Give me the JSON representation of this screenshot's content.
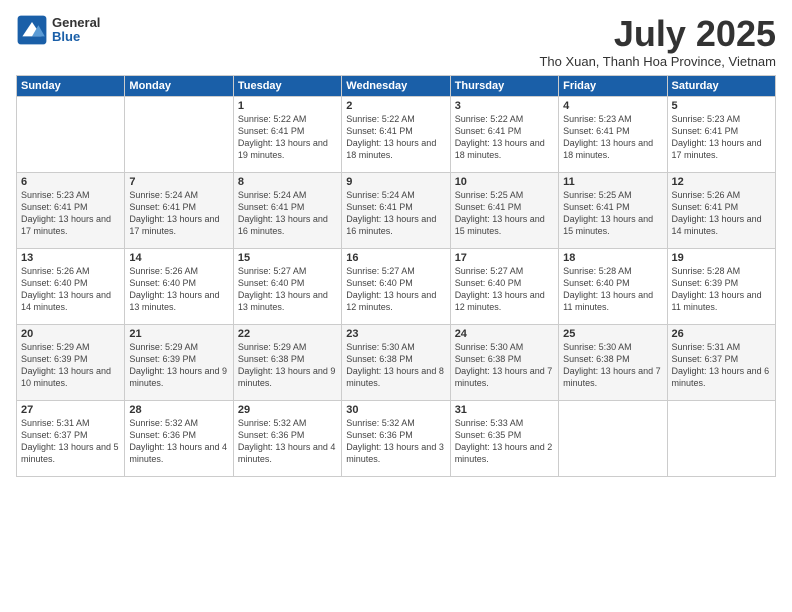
{
  "logo": {
    "general": "General",
    "blue": "Blue"
  },
  "title": "July 2025",
  "subtitle": "Tho Xuan, Thanh Hoa Province, Vietnam",
  "weekdays": [
    "Sunday",
    "Monday",
    "Tuesday",
    "Wednesday",
    "Thursday",
    "Friday",
    "Saturday"
  ],
  "weeks": [
    [
      {
        "day": "",
        "info": ""
      },
      {
        "day": "",
        "info": ""
      },
      {
        "day": "1",
        "info": "Sunrise: 5:22 AM\nSunset: 6:41 PM\nDaylight: 13 hours and 19 minutes."
      },
      {
        "day": "2",
        "info": "Sunrise: 5:22 AM\nSunset: 6:41 PM\nDaylight: 13 hours and 18 minutes."
      },
      {
        "day": "3",
        "info": "Sunrise: 5:22 AM\nSunset: 6:41 PM\nDaylight: 13 hours and 18 minutes."
      },
      {
        "day": "4",
        "info": "Sunrise: 5:23 AM\nSunset: 6:41 PM\nDaylight: 13 hours and 18 minutes."
      },
      {
        "day": "5",
        "info": "Sunrise: 5:23 AM\nSunset: 6:41 PM\nDaylight: 13 hours and 17 minutes."
      }
    ],
    [
      {
        "day": "6",
        "info": "Sunrise: 5:23 AM\nSunset: 6:41 PM\nDaylight: 13 hours and 17 minutes."
      },
      {
        "day": "7",
        "info": "Sunrise: 5:24 AM\nSunset: 6:41 PM\nDaylight: 13 hours and 17 minutes."
      },
      {
        "day": "8",
        "info": "Sunrise: 5:24 AM\nSunset: 6:41 PM\nDaylight: 13 hours and 16 minutes."
      },
      {
        "day": "9",
        "info": "Sunrise: 5:24 AM\nSunset: 6:41 PM\nDaylight: 13 hours and 16 minutes."
      },
      {
        "day": "10",
        "info": "Sunrise: 5:25 AM\nSunset: 6:41 PM\nDaylight: 13 hours and 15 minutes."
      },
      {
        "day": "11",
        "info": "Sunrise: 5:25 AM\nSunset: 6:41 PM\nDaylight: 13 hours and 15 minutes."
      },
      {
        "day": "12",
        "info": "Sunrise: 5:26 AM\nSunset: 6:41 PM\nDaylight: 13 hours and 14 minutes."
      }
    ],
    [
      {
        "day": "13",
        "info": "Sunrise: 5:26 AM\nSunset: 6:40 PM\nDaylight: 13 hours and 14 minutes."
      },
      {
        "day": "14",
        "info": "Sunrise: 5:26 AM\nSunset: 6:40 PM\nDaylight: 13 hours and 13 minutes."
      },
      {
        "day": "15",
        "info": "Sunrise: 5:27 AM\nSunset: 6:40 PM\nDaylight: 13 hours and 13 minutes."
      },
      {
        "day": "16",
        "info": "Sunrise: 5:27 AM\nSunset: 6:40 PM\nDaylight: 13 hours and 12 minutes."
      },
      {
        "day": "17",
        "info": "Sunrise: 5:27 AM\nSunset: 6:40 PM\nDaylight: 13 hours and 12 minutes."
      },
      {
        "day": "18",
        "info": "Sunrise: 5:28 AM\nSunset: 6:40 PM\nDaylight: 13 hours and 11 minutes."
      },
      {
        "day": "19",
        "info": "Sunrise: 5:28 AM\nSunset: 6:39 PM\nDaylight: 13 hours and 11 minutes."
      }
    ],
    [
      {
        "day": "20",
        "info": "Sunrise: 5:29 AM\nSunset: 6:39 PM\nDaylight: 13 hours and 10 minutes."
      },
      {
        "day": "21",
        "info": "Sunrise: 5:29 AM\nSunset: 6:39 PM\nDaylight: 13 hours and 9 minutes."
      },
      {
        "day": "22",
        "info": "Sunrise: 5:29 AM\nSunset: 6:38 PM\nDaylight: 13 hours and 9 minutes."
      },
      {
        "day": "23",
        "info": "Sunrise: 5:30 AM\nSunset: 6:38 PM\nDaylight: 13 hours and 8 minutes."
      },
      {
        "day": "24",
        "info": "Sunrise: 5:30 AM\nSunset: 6:38 PM\nDaylight: 13 hours and 7 minutes."
      },
      {
        "day": "25",
        "info": "Sunrise: 5:30 AM\nSunset: 6:38 PM\nDaylight: 13 hours and 7 minutes."
      },
      {
        "day": "26",
        "info": "Sunrise: 5:31 AM\nSunset: 6:37 PM\nDaylight: 13 hours and 6 minutes."
      }
    ],
    [
      {
        "day": "27",
        "info": "Sunrise: 5:31 AM\nSunset: 6:37 PM\nDaylight: 13 hours and 5 minutes."
      },
      {
        "day": "28",
        "info": "Sunrise: 5:32 AM\nSunset: 6:36 PM\nDaylight: 13 hours and 4 minutes."
      },
      {
        "day": "29",
        "info": "Sunrise: 5:32 AM\nSunset: 6:36 PM\nDaylight: 13 hours and 4 minutes."
      },
      {
        "day": "30",
        "info": "Sunrise: 5:32 AM\nSunset: 6:36 PM\nDaylight: 13 hours and 3 minutes."
      },
      {
        "day": "31",
        "info": "Sunrise: 5:33 AM\nSunset: 6:35 PM\nDaylight: 13 hours and 2 minutes."
      },
      {
        "day": "",
        "info": ""
      },
      {
        "day": "",
        "info": ""
      }
    ]
  ]
}
